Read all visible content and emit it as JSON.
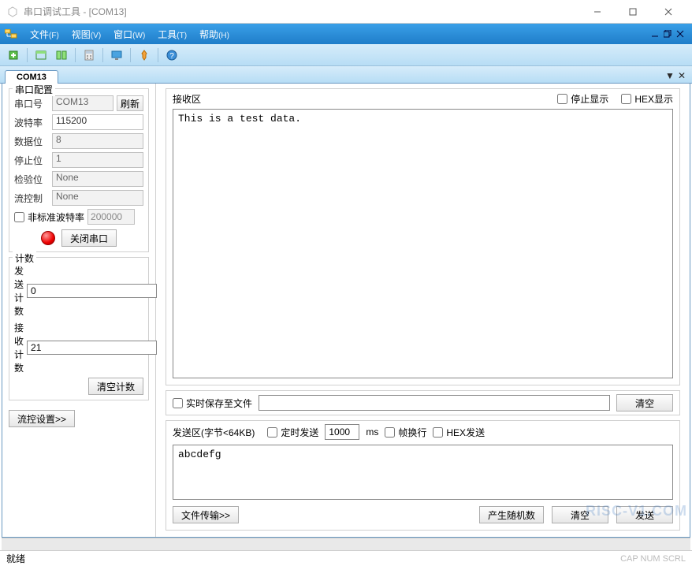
{
  "window": {
    "title": "串口调试工具 - [COM13]"
  },
  "menu": {
    "file": "文件",
    "file_k": "(F)",
    "view": "视图",
    "view_k": "(V)",
    "window": "窗口",
    "window_k": "(W)",
    "tools": "工具",
    "tools_k": "(T)",
    "help": "帮助",
    "help_k": "(H)"
  },
  "tab": {
    "label": "COM13"
  },
  "serial_config": {
    "legend": "串口配置",
    "port_label": "串口号",
    "port_value": "COM13",
    "refresh": "刷新",
    "baud_label": "波特率",
    "baud_value": "115200",
    "data_label": "数据位",
    "data_value": "8",
    "stop_label": "停止位",
    "stop_value": "1",
    "parity_label": "检验位",
    "parity_value": "None",
    "flow_label": "流控制",
    "flow_value": "None",
    "nonstd_label": "非标准波特率",
    "nonstd_value": "200000",
    "close_port": "关闭串口"
  },
  "counts": {
    "legend": "计数",
    "tx_label": "发送计数",
    "tx_value": "0",
    "rx_label": "接收计数",
    "rx_value": "21",
    "clear": "清空计数"
  },
  "flow_settings_btn": "流控设置>>",
  "rx": {
    "title": "接收区",
    "stop_display": "停止显示",
    "hex_display": "HEX显示",
    "content": "This is a test data.",
    "save_to_file": "实时保存至文件",
    "save_path": "",
    "clear": "清空"
  },
  "tx": {
    "title": "发送区(字节<64KB)",
    "timed_send": "定时发送",
    "interval": "1000",
    "ms": "ms",
    "line_wrap": "帧换行",
    "hex_send": "HEX发送",
    "content": "abcdefg",
    "file_transfer": "文件传输>>",
    "gen_random": "产生随机数",
    "clear": "清空",
    "send": "发送"
  },
  "status": {
    "ready": "就绪",
    "indicators": "CAP  NUM  SCRL"
  },
  "watermark": "RISC-V1.COM"
}
